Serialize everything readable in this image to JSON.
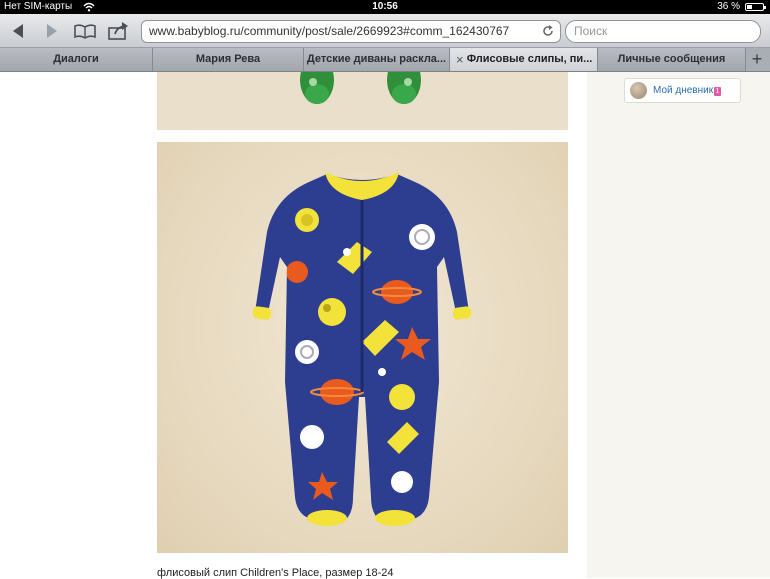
{
  "statusbar": {
    "carrier": "Нет SIM-карты",
    "time": "10:56",
    "battery": "36 %",
    "battery_level": 0.36
  },
  "toolbar": {
    "url": "www.babyblog.ru/community/post/sale/2669923#comm_162430767",
    "search_placeholder": "Поиск"
  },
  "tabs": [
    {
      "label": "Диалоги",
      "active": false
    },
    {
      "label": "Мария Рева",
      "active": false
    },
    {
      "label": "Детские диваны раскла...",
      "active": false
    },
    {
      "label": "Флисовые слипы, пи...",
      "active": true,
      "close": "×"
    },
    {
      "label": "Личные сообщения",
      "active": false
    }
  ],
  "tab_add": "+",
  "sidebar": {
    "diary_label": "Мой дневник",
    "diary_badge": "1"
  },
  "post": {
    "caption": "флисовый слип Children's Place, размер 18-24"
  },
  "colors": {
    "pajama_blue": "#2d3d8f",
    "pajama_yellow": "#f2e23a",
    "pajama_orange": "#e85a1e",
    "link": "#2a6ea8"
  }
}
